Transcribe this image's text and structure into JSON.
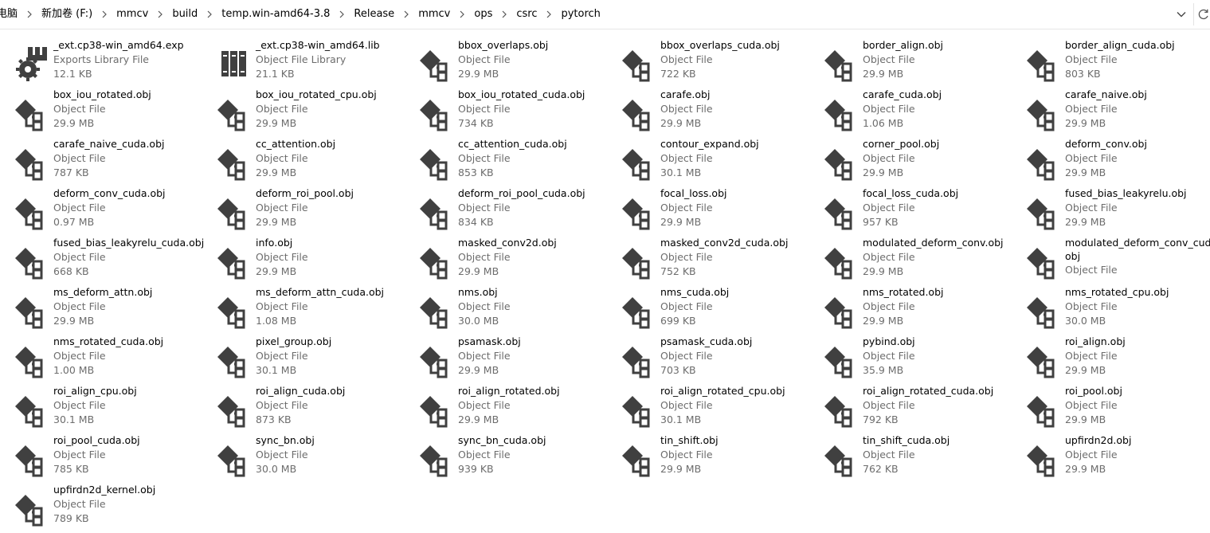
{
  "breadcrumb": [
    "电脑",
    "新加卷 (F:)",
    "mmcv",
    "build",
    "temp.win-amd64-3.8",
    "Release",
    "mmcv",
    "ops",
    "csrc",
    "pytorch"
  ],
  "files": [
    {
      "name": "_ext.cp38-win_amd64.exp",
      "type": "Exports Library File",
      "size": "12.1 KB",
      "icon": "gear-icon"
    },
    {
      "name": "_ext.cp38-win_amd64.lib",
      "type": "Object File Library",
      "size": "21.1 KB",
      "icon": "library-icon"
    },
    {
      "name": "bbox_overlaps.obj",
      "type": "Object File",
      "size": "29.9 MB",
      "icon": "object-file-icon"
    },
    {
      "name": "bbox_overlaps_cuda.obj",
      "type": "Object File",
      "size": "722 KB",
      "icon": "object-file-icon"
    },
    {
      "name": "border_align.obj",
      "type": "Object File",
      "size": "29.9 MB",
      "icon": "object-file-icon"
    },
    {
      "name": "border_align_cuda.obj",
      "type": "Object File",
      "size": "803 KB",
      "icon": "object-file-icon"
    },
    {
      "name": "box_iou_rotated.obj",
      "type": "Object File",
      "size": "29.9 MB",
      "icon": "object-file-icon"
    },
    {
      "name": "box_iou_rotated_cpu.obj",
      "type": "Object File",
      "size": "29.9 MB",
      "icon": "object-file-icon"
    },
    {
      "name": "box_iou_rotated_cuda.obj",
      "type": "Object File",
      "size": "734 KB",
      "icon": "object-file-icon"
    },
    {
      "name": "carafe.obj",
      "type": "Object File",
      "size": "29.9 MB",
      "icon": "object-file-icon"
    },
    {
      "name": "carafe_cuda.obj",
      "type": "Object File",
      "size": "1.06 MB",
      "icon": "object-file-icon"
    },
    {
      "name": "carafe_naive.obj",
      "type": "Object File",
      "size": "29.9 MB",
      "icon": "object-file-icon"
    },
    {
      "name": "carafe_naive_cuda.obj",
      "type": "Object File",
      "size": "787 KB",
      "icon": "object-file-icon"
    },
    {
      "name": "cc_attention.obj",
      "type": "Object File",
      "size": "29.9 MB",
      "icon": "object-file-icon"
    },
    {
      "name": "cc_attention_cuda.obj",
      "type": "Object File",
      "size": "853 KB",
      "icon": "object-file-icon"
    },
    {
      "name": "contour_expand.obj",
      "type": "Object File",
      "size": "30.1 MB",
      "icon": "object-file-icon"
    },
    {
      "name": "corner_pool.obj",
      "type": "Object File",
      "size": "29.9 MB",
      "icon": "object-file-icon"
    },
    {
      "name": "deform_conv.obj",
      "type": "Object File",
      "size": "29.9 MB",
      "icon": "object-file-icon"
    },
    {
      "name": "deform_conv_cuda.obj",
      "type": "Object File",
      "size": "0.97 MB",
      "icon": "object-file-icon"
    },
    {
      "name": "deform_roi_pool.obj",
      "type": "Object File",
      "size": "29.9 MB",
      "icon": "object-file-icon"
    },
    {
      "name": "deform_roi_pool_cuda.obj",
      "type": "Object File",
      "size": "834 KB",
      "icon": "object-file-icon"
    },
    {
      "name": "focal_loss.obj",
      "type": "Object File",
      "size": "29.9 MB",
      "icon": "object-file-icon"
    },
    {
      "name": "focal_loss_cuda.obj",
      "type": "Object File",
      "size": "957 KB",
      "icon": "object-file-icon"
    },
    {
      "name": "fused_bias_leakyrelu.obj",
      "type": "Object File",
      "size": "29.9 MB",
      "icon": "object-file-icon"
    },
    {
      "name": "fused_bias_leakyrelu_cuda.obj",
      "type": "Object File",
      "size": "668 KB",
      "icon": "object-file-icon"
    },
    {
      "name": "info.obj",
      "type": "Object File",
      "size": "29.9 MB",
      "icon": "object-file-icon"
    },
    {
      "name": "masked_conv2d.obj",
      "type": "Object File",
      "size": "29.9 MB",
      "icon": "object-file-icon"
    },
    {
      "name": "masked_conv2d_cuda.obj",
      "type": "Object File",
      "size": "752 KB",
      "icon": "object-file-icon"
    },
    {
      "name": "modulated_deform_conv.obj",
      "type": "Object File",
      "size": "29.9 MB",
      "icon": "object-file-icon"
    },
    {
      "name": "modulated_deform_conv_cuda.obj",
      "type": "Object File",
      "size": "",
      "icon": "object-file-icon",
      "wrap": true
    },
    {
      "name": "ms_deform_attn.obj",
      "type": "Object File",
      "size": "29.9 MB",
      "icon": "object-file-icon"
    },
    {
      "name": "ms_deform_attn_cuda.obj",
      "type": "Object File",
      "size": "1.08 MB",
      "icon": "object-file-icon"
    },
    {
      "name": "nms.obj",
      "type": "Object File",
      "size": "30.0 MB",
      "icon": "object-file-icon"
    },
    {
      "name": "nms_cuda.obj",
      "type": "Object File",
      "size": "699 KB",
      "icon": "object-file-icon"
    },
    {
      "name": "nms_rotated.obj",
      "type": "Object File",
      "size": "29.9 MB",
      "icon": "object-file-icon"
    },
    {
      "name": "nms_rotated_cpu.obj",
      "type": "Object File",
      "size": "30.0 MB",
      "icon": "object-file-icon"
    },
    {
      "name": "nms_rotated_cuda.obj",
      "type": "Object File",
      "size": "1.00 MB",
      "icon": "object-file-icon"
    },
    {
      "name": "pixel_group.obj",
      "type": "Object File",
      "size": "30.1 MB",
      "icon": "object-file-icon"
    },
    {
      "name": "psamask.obj",
      "type": "Object File",
      "size": "29.9 MB",
      "icon": "object-file-icon"
    },
    {
      "name": "psamask_cuda.obj",
      "type": "Object File",
      "size": "703 KB",
      "icon": "object-file-icon"
    },
    {
      "name": "pybind.obj",
      "type": "Object File",
      "size": "35.9 MB",
      "icon": "object-file-icon"
    },
    {
      "name": "roi_align.obj",
      "type": "Object File",
      "size": "29.9 MB",
      "icon": "object-file-icon"
    },
    {
      "name": "roi_align_cpu.obj",
      "type": "Object File",
      "size": "30.1 MB",
      "icon": "object-file-icon"
    },
    {
      "name": "roi_align_cuda.obj",
      "type": "Object File",
      "size": "873 KB",
      "icon": "object-file-icon"
    },
    {
      "name": "roi_align_rotated.obj",
      "type": "Object File",
      "size": "29.9 MB",
      "icon": "object-file-icon"
    },
    {
      "name": "roi_align_rotated_cpu.obj",
      "type": "Object File",
      "size": "30.1 MB",
      "icon": "object-file-icon"
    },
    {
      "name": "roi_align_rotated_cuda.obj",
      "type": "Object File",
      "size": "792 KB",
      "icon": "object-file-icon"
    },
    {
      "name": "roi_pool.obj",
      "type": "Object File",
      "size": "29.9 MB",
      "icon": "object-file-icon"
    },
    {
      "name": "roi_pool_cuda.obj",
      "type": "Object File",
      "size": "785 KB",
      "icon": "object-file-icon"
    },
    {
      "name": "sync_bn.obj",
      "type": "Object File",
      "size": "30.0 MB",
      "icon": "object-file-icon"
    },
    {
      "name": "sync_bn_cuda.obj",
      "type": "Object File",
      "size": "939 KB",
      "icon": "object-file-icon"
    },
    {
      "name": "tin_shift.obj",
      "type": "Object File",
      "size": "29.9 MB",
      "icon": "object-file-icon"
    },
    {
      "name": "tin_shift_cuda.obj",
      "type": "Object File",
      "size": "762 KB",
      "icon": "object-file-icon"
    },
    {
      "name": "upfirdn2d.obj",
      "type": "Object File",
      "size": "29.9 MB",
      "icon": "object-file-icon"
    },
    {
      "name": "upfirdn2d_kernel.obj",
      "type": "Object File",
      "size": "789 KB",
      "icon": "object-file-icon"
    }
  ],
  "colors": {
    "secondary_text": "#6d6d6d",
    "icon_dark": "#404040"
  }
}
